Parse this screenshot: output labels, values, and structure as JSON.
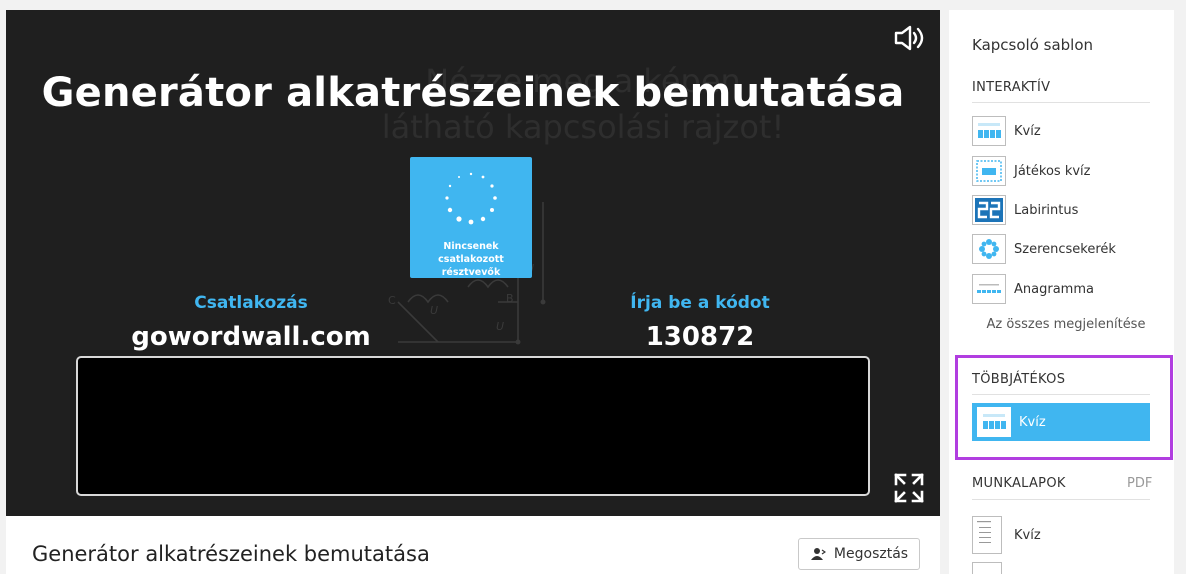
{
  "stage": {
    "bg_line1": "Nézze meg a képen",
    "bg_line2": "látható kapcsolási rajzot!",
    "headline": "Generátor alkatrészeinek bemutatása",
    "status_message": "Nincsenek csatlakozott résztvevők",
    "join_label": "Csatlakozás",
    "join_url": "gowordwall.com",
    "code_label": "Írja be a kódot",
    "code_value": "130872",
    "circuit_labels": {
      "b": "B",
      "c": "C",
      "uc": "U",
      "uac": "U"
    },
    "icons": [
      "speaker-icon",
      "fullscreen-icon",
      "spinner-icon"
    ]
  },
  "title_bar": {
    "title": "Generátor alkatrészeinek bemutatása",
    "share_label": "Megosztás",
    "share_icon": "person-share-icon"
  },
  "sidebar": {
    "title": "Kapcsoló sablon",
    "interactive_header": "INTERAKTÍV",
    "interactive_items": [
      {
        "label": "Kvíz",
        "icon": "quiz-thumb-icon"
      },
      {
        "label": "Játékos kvíz",
        "icon": "gameshow-quiz-thumb-icon"
      },
      {
        "label": "Labirintus",
        "icon": "maze-thumb-icon"
      },
      {
        "label": "Szerencsekerék",
        "icon": "spin-wheel-thumb-icon"
      },
      {
        "label": "Anagramma",
        "icon": "anagram-thumb-icon"
      }
    ],
    "show_all": "Az összes megjelenítése",
    "multiplayer_header": "TÖBBJÁTÉKOS",
    "multiplayer_items": [
      {
        "label": "Kvíz",
        "icon": "quiz-thumb-icon",
        "selected": true
      }
    ],
    "worksheets_header": "MUNKALAPOK",
    "worksheets_pdf": "PDF",
    "worksheet_items": [
      {
        "label": "Kvíz",
        "icon": "worksheet-thumb-icon"
      }
    ]
  },
  "colors": {
    "accent": "#40b6f0",
    "stage_bg": "#1f1f1f",
    "highlight": "#b13ee0"
  }
}
